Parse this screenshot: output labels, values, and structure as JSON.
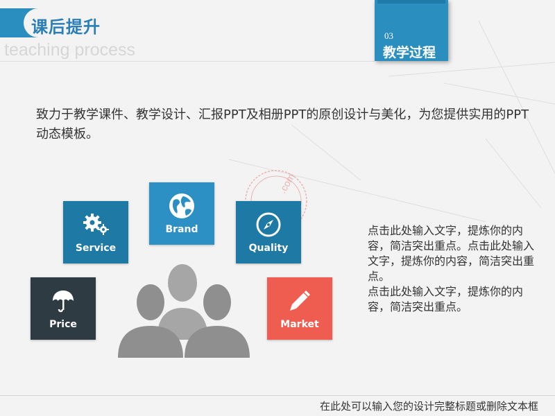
{
  "header": {
    "title": "课后提升",
    "subtitle_en": "teaching process",
    "section_number": "03",
    "section_label": "教学过程"
  },
  "intro": {
    "text": "致力于教学课件、教学设计、汇报PPT及相册PPT的原创设计与美化，为您提供实用的PPT动态模板。"
  },
  "tiles": [
    {
      "label": "Service",
      "icon": "gears-icon",
      "color": "#1e7aa5"
    },
    {
      "label": "Brand",
      "icon": "globe-icon",
      "color": "#2d90c4"
    },
    {
      "label": "Quality",
      "icon": "compass-icon",
      "color": "#1e7aa5"
    },
    {
      "label": "Price",
      "icon": "umbrella-icon",
      "color": "#2f3b43"
    },
    {
      "label": "Market",
      "icon": "pencil-icon",
      "color": "#ef5d51"
    }
  ],
  "side_text": {
    "paragraph_1": "点击此处输入文字，提炼你的内容，简洁突出重点。点击此处输入文字，提炼你的内容，简洁突出重点。",
    "paragraph_2": "点击此处输入文字，提炼你的内容，简洁突出重点。"
  },
  "footer": {
    "text": "在此处可以输入您的设计完整标题或删除文本框"
  },
  "colors": {
    "accent": "#2a8ebf",
    "dark": "#2f3b43",
    "red": "#ef5d51",
    "people": "#8f8f8f"
  }
}
